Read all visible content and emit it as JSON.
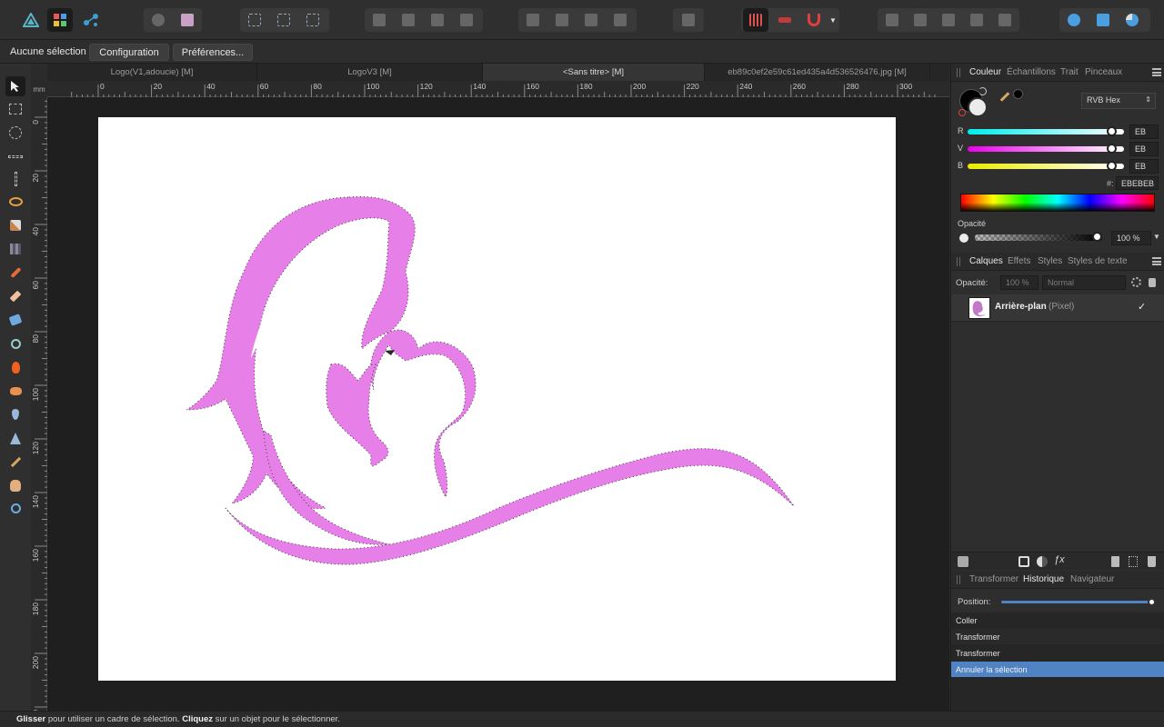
{
  "toolbar": {
    "personas": [
      "designer-persona-icon",
      "photo-persona-icon",
      "export-persona-icon"
    ],
    "snapping_label": "▼"
  },
  "context": {
    "selection": "Aucune sélection",
    "config_button": "Configuration",
    "prefs_button": "Préférences..."
  },
  "tabs": [
    {
      "label": "Logo(V1,adoucie) [M]"
    },
    {
      "label": "LogoV3 [M]"
    },
    {
      "label": "<Sans titre> [M]"
    },
    {
      "label": "eb89c0ef2e59c61ed435a4d536526476.jpg [M]"
    }
  ],
  "ruler": {
    "unit": "mm",
    "top_ticks": [
      "0",
      "20",
      "40",
      "60",
      "80",
      "100",
      "120",
      "140",
      "160",
      "180",
      "200",
      "220",
      "240",
      "260",
      "280",
      "300"
    ],
    "left_ticks": [
      "0",
      "20",
      "40",
      "60",
      "80",
      "100",
      "120",
      "140",
      "160",
      "180",
      "200",
      "20"
    ]
  },
  "color_panel": {
    "tabs": [
      "Couleur",
      "Échantillons",
      "Trait",
      "Pinceaux"
    ],
    "mode": "RVB Hex",
    "r_label": "R",
    "r_value": "EB",
    "r_level": 0.92,
    "v_label": "V",
    "v_value": "EB",
    "v_level": 0.92,
    "b_label": "B",
    "b_value": "EB",
    "b_level": 0.92,
    "hex_label": "#:",
    "hex_value": "EBEBEB",
    "opacity_label": "Opacité",
    "opacity_value": "100 %",
    "opacity_level": 1.0
  },
  "layers_panel": {
    "tabs": [
      "Calques",
      "Effets",
      "Styles",
      "Styles de texte"
    ],
    "opacity_label": "Opacité:",
    "opacity_value": "100 %",
    "blend_mode": "Normal",
    "layer_name": "Arrière-plan",
    "layer_type": "(Pixel)",
    "layer_visible": "✓"
  },
  "history_panel": {
    "tabs": [
      "Transformer",
      "Historique",
      "Navigateur"
    ],
    "position_label": "Position:",
    "position_level": 1.0,
    "items": [
      "Coller",
      "Transformer",
      "Transformer",
      "Annuler la sélection"
    ]
  },
  "status": {
    "bold1": "Glisser",
    "text1": " pour utiliser un cadre de sélection. ",
    "bold2": "Cliquez",
    "text2": " sur un objet pour le sélectionner."
  },
  "colors": {
    "logo_pink": "#e680e8",
    "accent_blue": "#4f83c4",
    "panel_bg": "#2e2e2e"
  }
}
